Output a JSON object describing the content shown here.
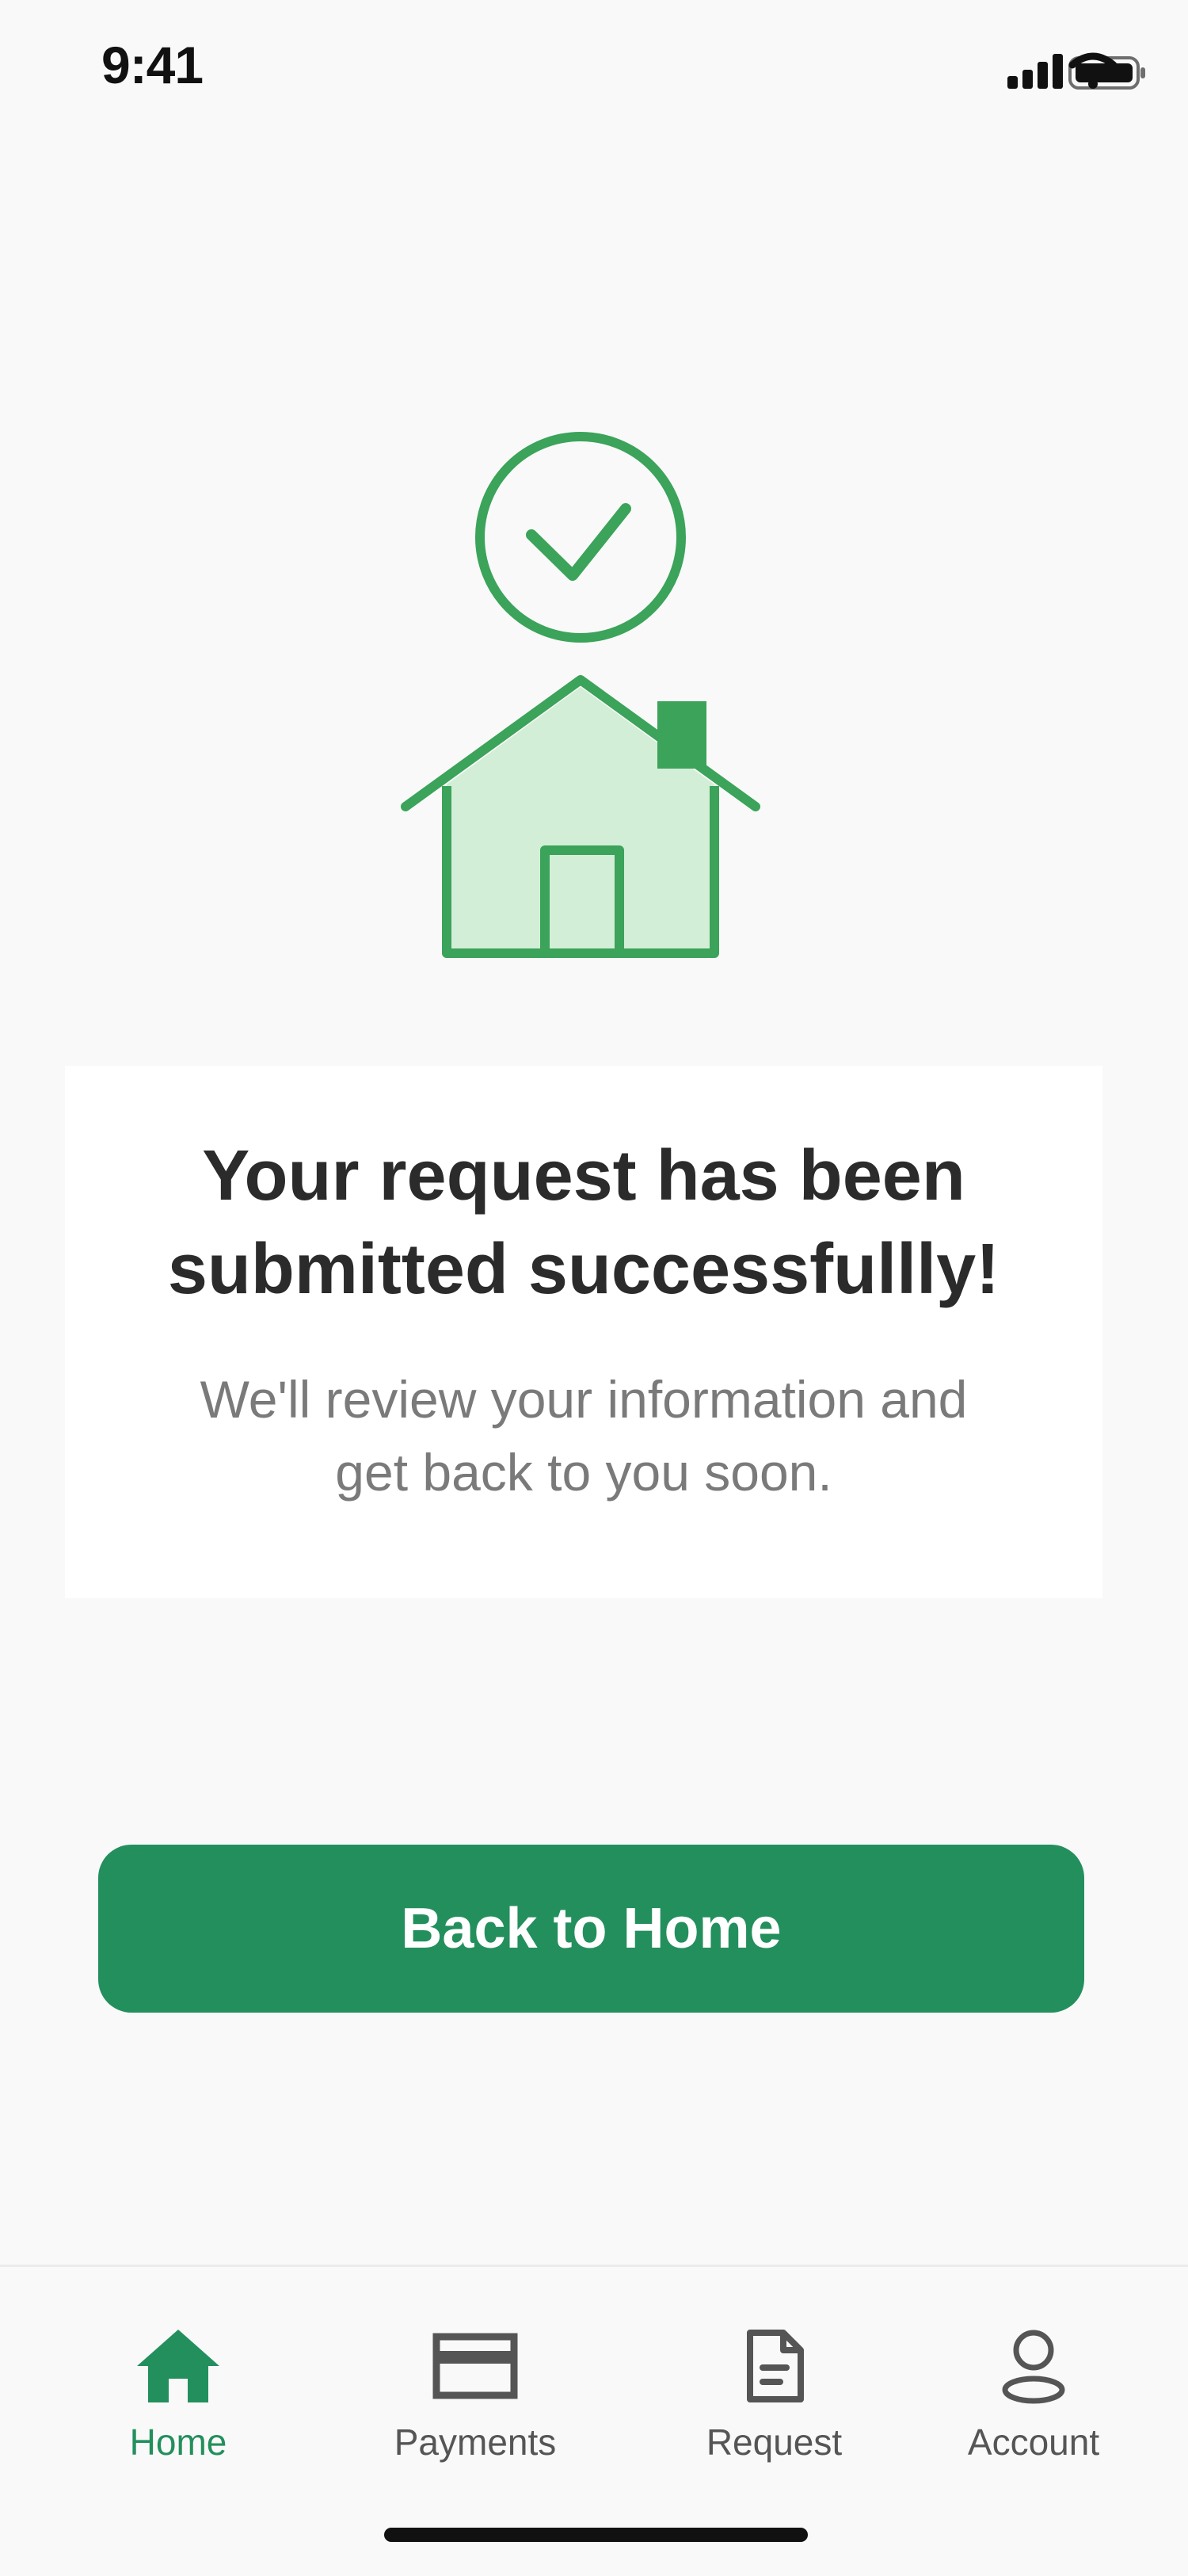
{
  "status_bar": {
    "time": "9:41",
    "icons": [
      "signal-icon",
      "wifi-icon",
      "battery-icon"
    ]
  },
  "illustration": {
    "icons": [
      "check-circle-icon",
      "house-icon"
    ],
    "accent_color": "#3ba35a",
    "fill_color": "#d2eed6"
  },
  "message": {
    "title_line1": "Your request has been",
    "title_line2": "submitted successfullly!",
    "body_line1": "We'll review your information and",
    "body_line2": "get back to you soon."
  },
  "actions": {
    "back_home_label": "Back to Home",
    "button_color": "#238f5d"
  },
  "bottom_nav": {
    "items": [
      {
        "label": "Home",
        "icon": "home-icon",
        "active": true
      },
      {
        "label": "Payments",
        "icon": "credit-card-icon",
        "active": false
      },
      {
        "label": "Request",
        "icon": "document-icon",
        "active": false
      },
      {
        "label": "Account",
        "icon": "user-icon",
        "active": false
      }
    ],
    "active_color": "#238f5d",
    "inactive_color": "#555555"
  }
}
